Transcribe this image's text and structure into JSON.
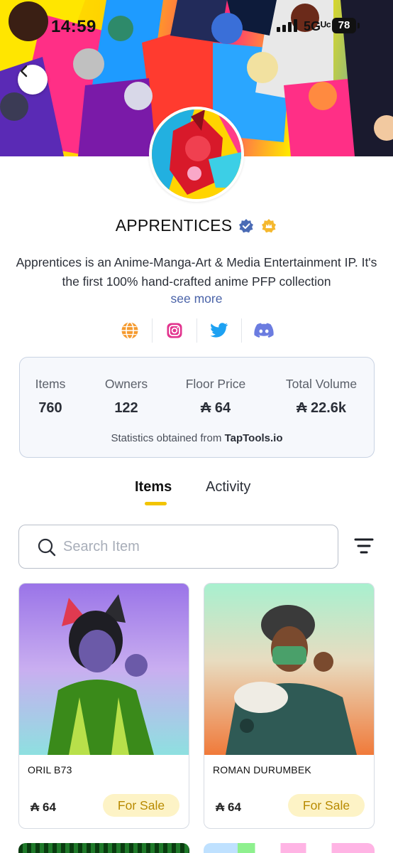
{
  "status_bar": {
    "time": "14:59",
    "network": "5Gᵁᶜ",
    "battery": "78"
  },
  "collection": {
    "name": "APPRENTICES",
    "description": "Apprentices is an Anime-Manga-Art & Media Entertainment IP. It's the first 100% hand-crafted anime  PFP collection",
    "see_more": "see more"
  },
  "stats": {
    "items_label": "Items",
    "items_value": "760",
    "owners_label": "Owners",
    "owners_value": "122",
    "floor_label": "Floor Price",
    "floor_value": "₳ 64",
    "volume_label": "Total Volume",
    "volume_value": "₳ 22.6k",
    "note": "Statistics obtained from",
    "note_source": "TapTools.io"
  },
  "tabs": [
    {
      "label": "Items",
      "active": true
    },
    {
      "label": "Activity",
      "active": false
    }
  ],
  "search": {
    "placeholder": "Search Item"
  },
  "items": [
    {
      "name": "ORIL B73",
      "price": "₳ 64",
      "status": "For Sale"
    },
    {
      "name": "ROMAN DURUMBEK",
      "price": "₳ 64",
      "status": "For Sale"
    }
  ],
  "colors": {
    "accent_yellow": "#f2c400",
    "link_blue": "#4a63a8",
    "sale_badge_bg": "#fdf3c6",
    "sale_badge_text": "#b88a00",
    "verified_blue": "#4a6bb5",
    "badge_gold": "#f5b82e",
    "website_orange": "#f59a2e",
    "instagram_pink": "#e2348e",
    "twitter_blue": "#1da1f2",
    "discord_purple": "#6b7ce0"
  },
  "icons": {
    "back": "chevron-left-icon",
    "verified": "verified-badge-icon",
    "gold": "gold-badge-icon",
    "website": "globe-icon",
    "instagram": "instagram-icon",
    "twitter": "twitter-icon",
    "discord": "discord-icon",
    "search": "search-icon",
    "filter": "filter-icon"
  }
}
